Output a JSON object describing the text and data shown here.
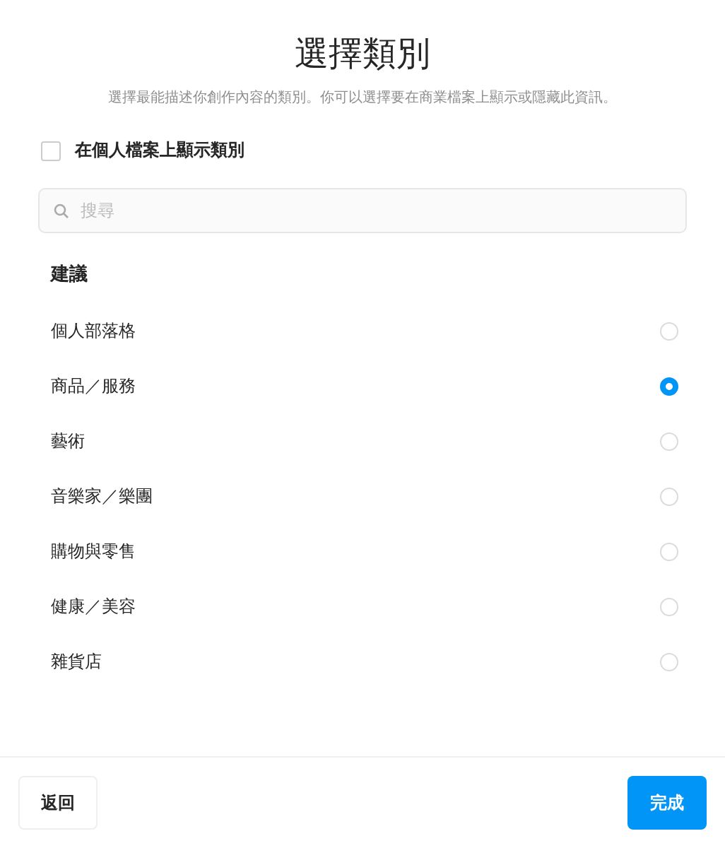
{
  "title": "選擇類別",
  "subtitle": "選擇最能描述你創作內容的類別。你可以選擇要在商業檔案上顯示或隱藏此資訊。",
  "show_on_profile": {
    "label": "在個人檔案上顯示類別",
    "checked": false
  },
  "search": {
    "placeholder": "搜尋"
  },
  "section_heading": "建議",
  "categories": [
    {
      "label": "個人部落格",
      "selected": false
    },
    {
      "label": "商品／服務",
      "selected": true
    },
    {
      "label": "藝術",
      "selected": false
    },
    {
      "label": "音樂家／樂團",
      "selected": false
    },
    {
      "label": "購物與零售",
      "selected": false
    },
    {
      "label": "健康／美容",
      "selected": false
    },
    {
      "label": "雜貨店",
      "selected": false
    }
  ],
  "buttons": {
    "back": "返回",
    "done": "完成"
  }
}
